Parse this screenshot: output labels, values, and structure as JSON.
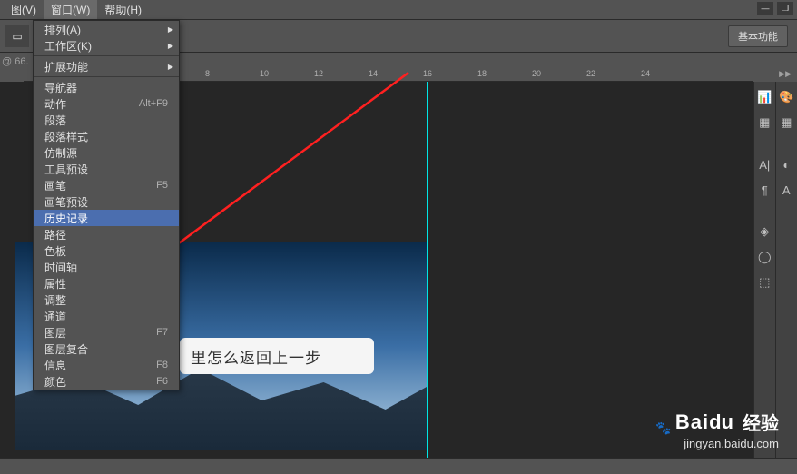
{
  "menubar": {
    "view": "图(V)",
    "window": "窗口(W)",
    "help": "帮助(H)"
  },
  "zoom": "@ 66.",
  "toolbar": {
    "basic_label": "基本功能"
  },
  "dropdown": {
    "items": [
      {
        "label": "排列(A)",
        "arrow": true
      },
      {
        "label": "工作区(K)",
        "arrow": true
      },
      {
        "sep": true
      },
      {
        "label": "扩展功能",
        "arrow": true
      },
      {
        "sep": true
      },
      {
        "label": "导航器"
      },
      {
        "label": "动作",
        "shortcut": "Alt+F9"
      },
      {
        "label": "段落"
      },
      {
        "label": "段落样式"
      },
      {
        "label": "仿制源"
      },
      {
        "label": "工具预设"
      },
      {
        "label": "画笔",
        "shortcut": "F5"
      },
      {
        "label": "画笔预设"
      },
      {
        "label": "历史记录",
        "highlight": true
      },
      {
        "label": "路径"
      },
      {
        "label": "色板"
      },
      {
        "label": "时间轴"
      },
      {
        "label": "属性"
      },
      {
        "label": "调整"
      },
      {
        "label": "通道"
      },
      {
        "label": "图层",
        "shortcut": "F7"
      },
      {
        "label": "图层复合"
      },
      {
        "label": "信息",
        "shortcut": "F8"
      },
      {
        "label": "颜色",
        "shortcut": "F6"
      }
    ]
  },
  "ruler": [
    "8",
    "10",
    "12",
    "14",
    "16",
    "18",
    "20",
    "22",
    "24"
  ],
  "canvas_text": "里怎么返回上一步",
  "rail_icons_left": [
    "histogram-icon",
    "swatches-icon",
    "type-icon",
    "paragraph-icon",
    "layers-icon",
    "paths-icon",
    "mesh-icon"
  ],
  "rail_icons_right": [
    "color-icon",
    "swatch-grid-icon",
    "circle-icon",
    "character-icon"
  ],
  "watermark": {
    "brand_prefix": "Bai",
    "brand_suffix": "du",
    "cn": "经验",
    "url": "jingyan.baidu.com"
  }
}
